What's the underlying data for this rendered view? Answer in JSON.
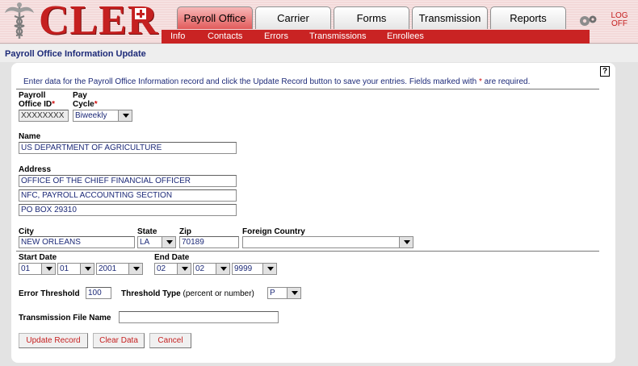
{
  "header": {
    "logo_text": "CLER",
    "tabs": [
      {
        "label": "Payroll Office",
        "active": true
      },
      {
        "label": "Carrier",
        "active": false
      },
      {
        "label": "Forms",
        "active": false
      },
      {
        "label": "Transmission",
        "active": false
      },
      {
        "label": "Reports",
        "active": false
      }
    ],
    "subnav": [
      "Info",
      "Contacts",
      "Errors",
      "Transmissions",
      "Enrollees"
    ],
    "logoff_line1": "LOG",
    "logoff_line2": "OFF",
    "icons": {
      "logo": "caduceus-icon",
      "settings": "gear-icon"
    },
    "colors": {
      "brand_red": "#c52020",
      "nav_red": "#c92323",
      "title_blue": "#1d2a78"
    }
  },
  "page": {
    "title": "Payroll Office Information Update",
    "help_label": "?",
    "instructions_before": "Enter data for the Payroll Office Information record and click the Update Record button to save your entries.  Fields marked with",
    "required_mark": "*",
    "instructions_after": "are required."
  },
  "form": {
    "payroll_office_id": {
      "label_line1": "Payroll",
      "label_line2": "Office ID",
      "value": "XXXXXXXX"
    },
    "pay_cycle": {
      "label_line1": "Pay",
      "label_line2": "Cycle",
      "value": "Biweekly"
    },
    "name": {
      "label": "Name",
      "value": "US DEPARTMENT OF AGRICULTURE"
    },
    "address": {
      "label": "Address",
      "line1": "OFFICE OF THE CHIEF FINANCIAL OFFICER",
      "line2": "NFC, PAYROLL ACCOUNTING SECTION",
      "line3": "PO BOX 29310"
    },
    "city": {
      "label": "City",
      "value": "NEW ORLEANS"
    },
    "state": {
      "label": "State",
      "value": "LA"
    },
    "zip": {
      "label": "Zip",
      "value": "70189"
    },
    "foreign_country": {
      "label": "Foreign Country",
      "value": ""
    },
    "start_date": {
      "label": "Start Date",
      "month": "01",
      "day": "01",
      "year": "2001"
    },
    "end_date": {
      "label": "End Date",
      "month": "02",
      "day": "02",
      "year": "9999"
    },
    "error_threshold": {
      "label": "Error Threshold",
      "value": "100"
    },
    "threshold_type": {
      "label": "Threshold Type",
      "hint": "(percent or number)",
      "value": "P"
    },
    "transmission_file_name": {
      "label": "Transmission File Name",
      "value": ""
    }
  },
  "buttons": {
    "update": "Update Record",
    "clear": "Clear Data",
    "cancel": "Cancel"
  }
}
